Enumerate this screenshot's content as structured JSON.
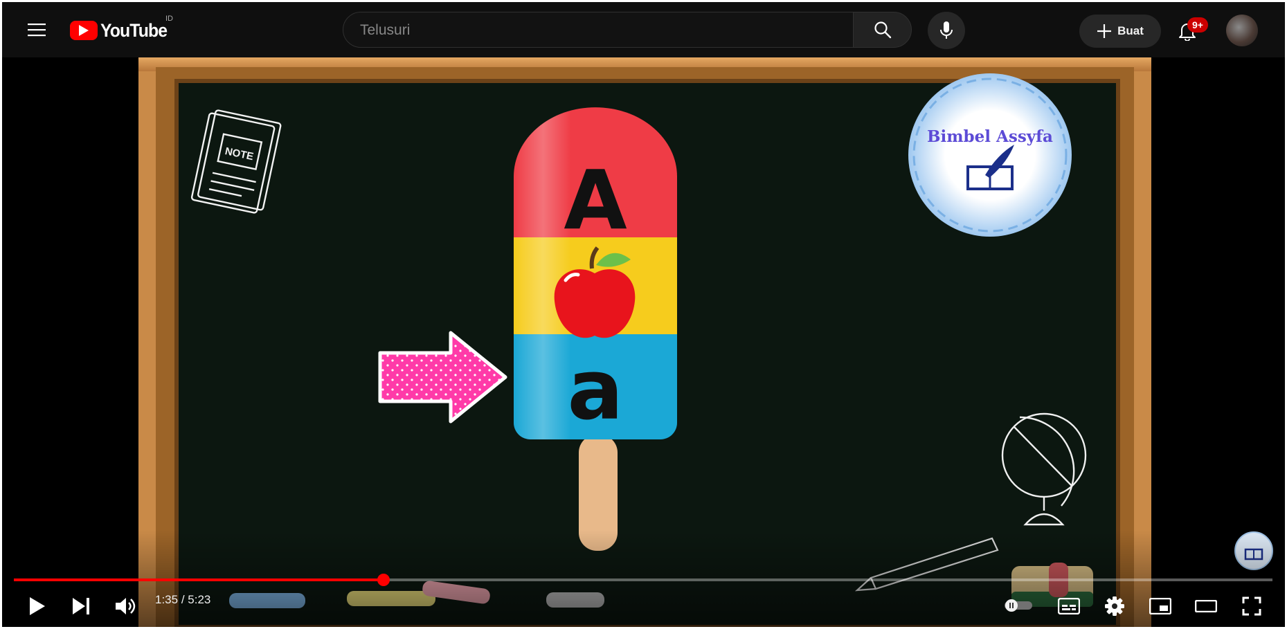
{
  "masthead": {
    "logo_text": "YouTube",
    "country_code": "ID",
    "search": {
      "placeholder": "Telusuri",
      "value": ""
    },
    "create_label": "Buat",
    "notification_count": "9+",
    "icons": {
      "menu": "hamburger-menu-icon",
      "search": "search-icon",
      "mic": "microphone-icon",
      "create": "plus-icon",
      "notifications": "bell-icon"
    }
  },
  "video": {
    "note_label": "NOTE",
    "upper_letter": "A",
    "lower_letter": "a",
    "brand_logo_text": "Bimbel Assyfa"
  },
  "player": {
    "current_time": "1:35",
    "duration": "5:23",
    "time_separator": " / ",
    "progress_fraction": 0.294,
    "accent_color": "#ff0000",
    "icons": {
      "play": "play-icon",
      "next": "next-icon",
      "volume": "volume-icon",
      "autoplay": "autoplay-toggle-icon",
      "subtitles": "subtitles-icon",
      "settings": "gear-icon",
      "miniplayer": "miniplayer-icon",
      "theater": "theater-mode-icon",
      "fullscreen": "fullscreen-icon"
    }
  }
}
